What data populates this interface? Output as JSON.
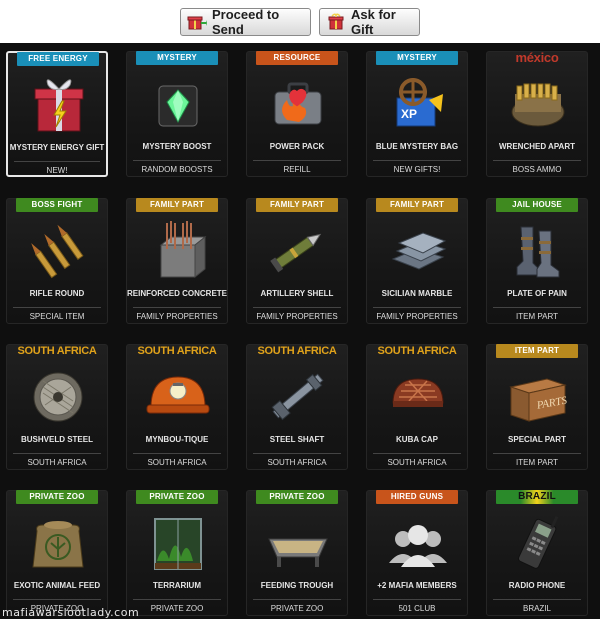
{
  "toolbar": {
    "send_label": "Proceed to Send",
    "ask_label": "Ask for Gift"
  },
  "watermark": "mafiawarslootlady.com",
  "banner_colors": {
    "teal": "#1a8fb8",
    "orange": "#c8541b",
    "green": "#3f8a1f",
    "gold": "#b8891e",
    "mexico": "#c0392b",
    "south_africa": "#e0a21a"
  },
  "items": [
    {
      "banner": "Free Energy",
      "name": "Mystery Energy Gift",
      "category": "New!",
      "icon": "gift-icon",
      "selected": true
    },
    {
      "banner": "Mystery",
      "name": "Mystery Boost",
      "category": "Random Boosts",
      "icon": "crystal-box-icon"
    },
    {
      "banner": "Resource",
      "name": "Power Pack",
      "category": "Refill",
      "icon": "power-pack-icon"
    },
    {
      "banner": "Mystery",
      "name": "Blue Mystery Bag",
      "category": "New Gifts!",
      "icon": "mystery-bag-icon"
    },
    {
      "banner": "México",
      "name": "Wrenched Apart",
      "category": "Boss Ammo",
      "icon": "ammo-belt-icon"
    },
    {
      "banner": "Boss Fight",
      "name": "Rifle Round",
      "category": "Special Item",
      "icon": "bullets-icon"
    },
    {
      "banner": "Family Part",
      "name": "Reinforced Concrete",
      "category": "Family Properties",
      "icon": "concrete-icon"
    },
    {
      "banner": "Family Part",
      "name": "Artillery Shell",
      "category": "Family Properties",
      "icon": "shell-icon"
    },
    {
      "banner": "Family Part",
      "name": "Sicilian Marble",
      "category": "Family Properties",
      "icon": "marble-icon"
    },
    {
      "banner": "Jail House",
      "name": "Plate of Pain",
      "category": "Item Part",
      "icon": "boots-icon"
    },
    {
      "banner": "South Africa",
      "name": "Bushveld Steel",
      "category": "South Africa",
      "icon": "wire-spool-icon"
    },
    {
      "banner": "South Africa",
      "name": "Mynbou-Tique",
      "category": "South Africa",
      "icon": "mining-helmet-icon"
    },
    {
      "banner": "South Africa",
      "name": "Steel Shaft",
      "category": "South Africa",
      "icon": "shaft-icon"
    },
    {
      "banner": "South Africa",
      "name": "Kuba Cap",
      "category": "South Africa",
      "icon": "cap-icon"
    },
    {
      "banner": "Item Part",
      "name": "Special Part",
      "category": "Item Part",
      "icon": "crate-icon"
    },
    {
      "banner": "Private Zoo",
      "name": "Exotic Animal Feed",
      "category": "Private Zoo",
      "icon": "feed-sack-icon"
    },
    {
      "banner": "Private Zoo",
      "name": "Terrarium",
      "category": "Private Zoo",
      "icon": "terrarium-icon"
    },
    {
      "banner": "Private Zoo",
      "name": "Feeding Trough",
      "category": "Private Zoo",
      "icon": "trough-icon"
    },
    {
      "banner": "Hired Guns",
      "name": "+2 Mafia Members",
      "category": "501 Club",
      "icon": "members-icon"
    },
    {
      "banner": "Brazil",
      "name": "Radio Phone",
      "category": "Brazil",
      "icon": "radio-phone-icon"
    }
  ]
}
